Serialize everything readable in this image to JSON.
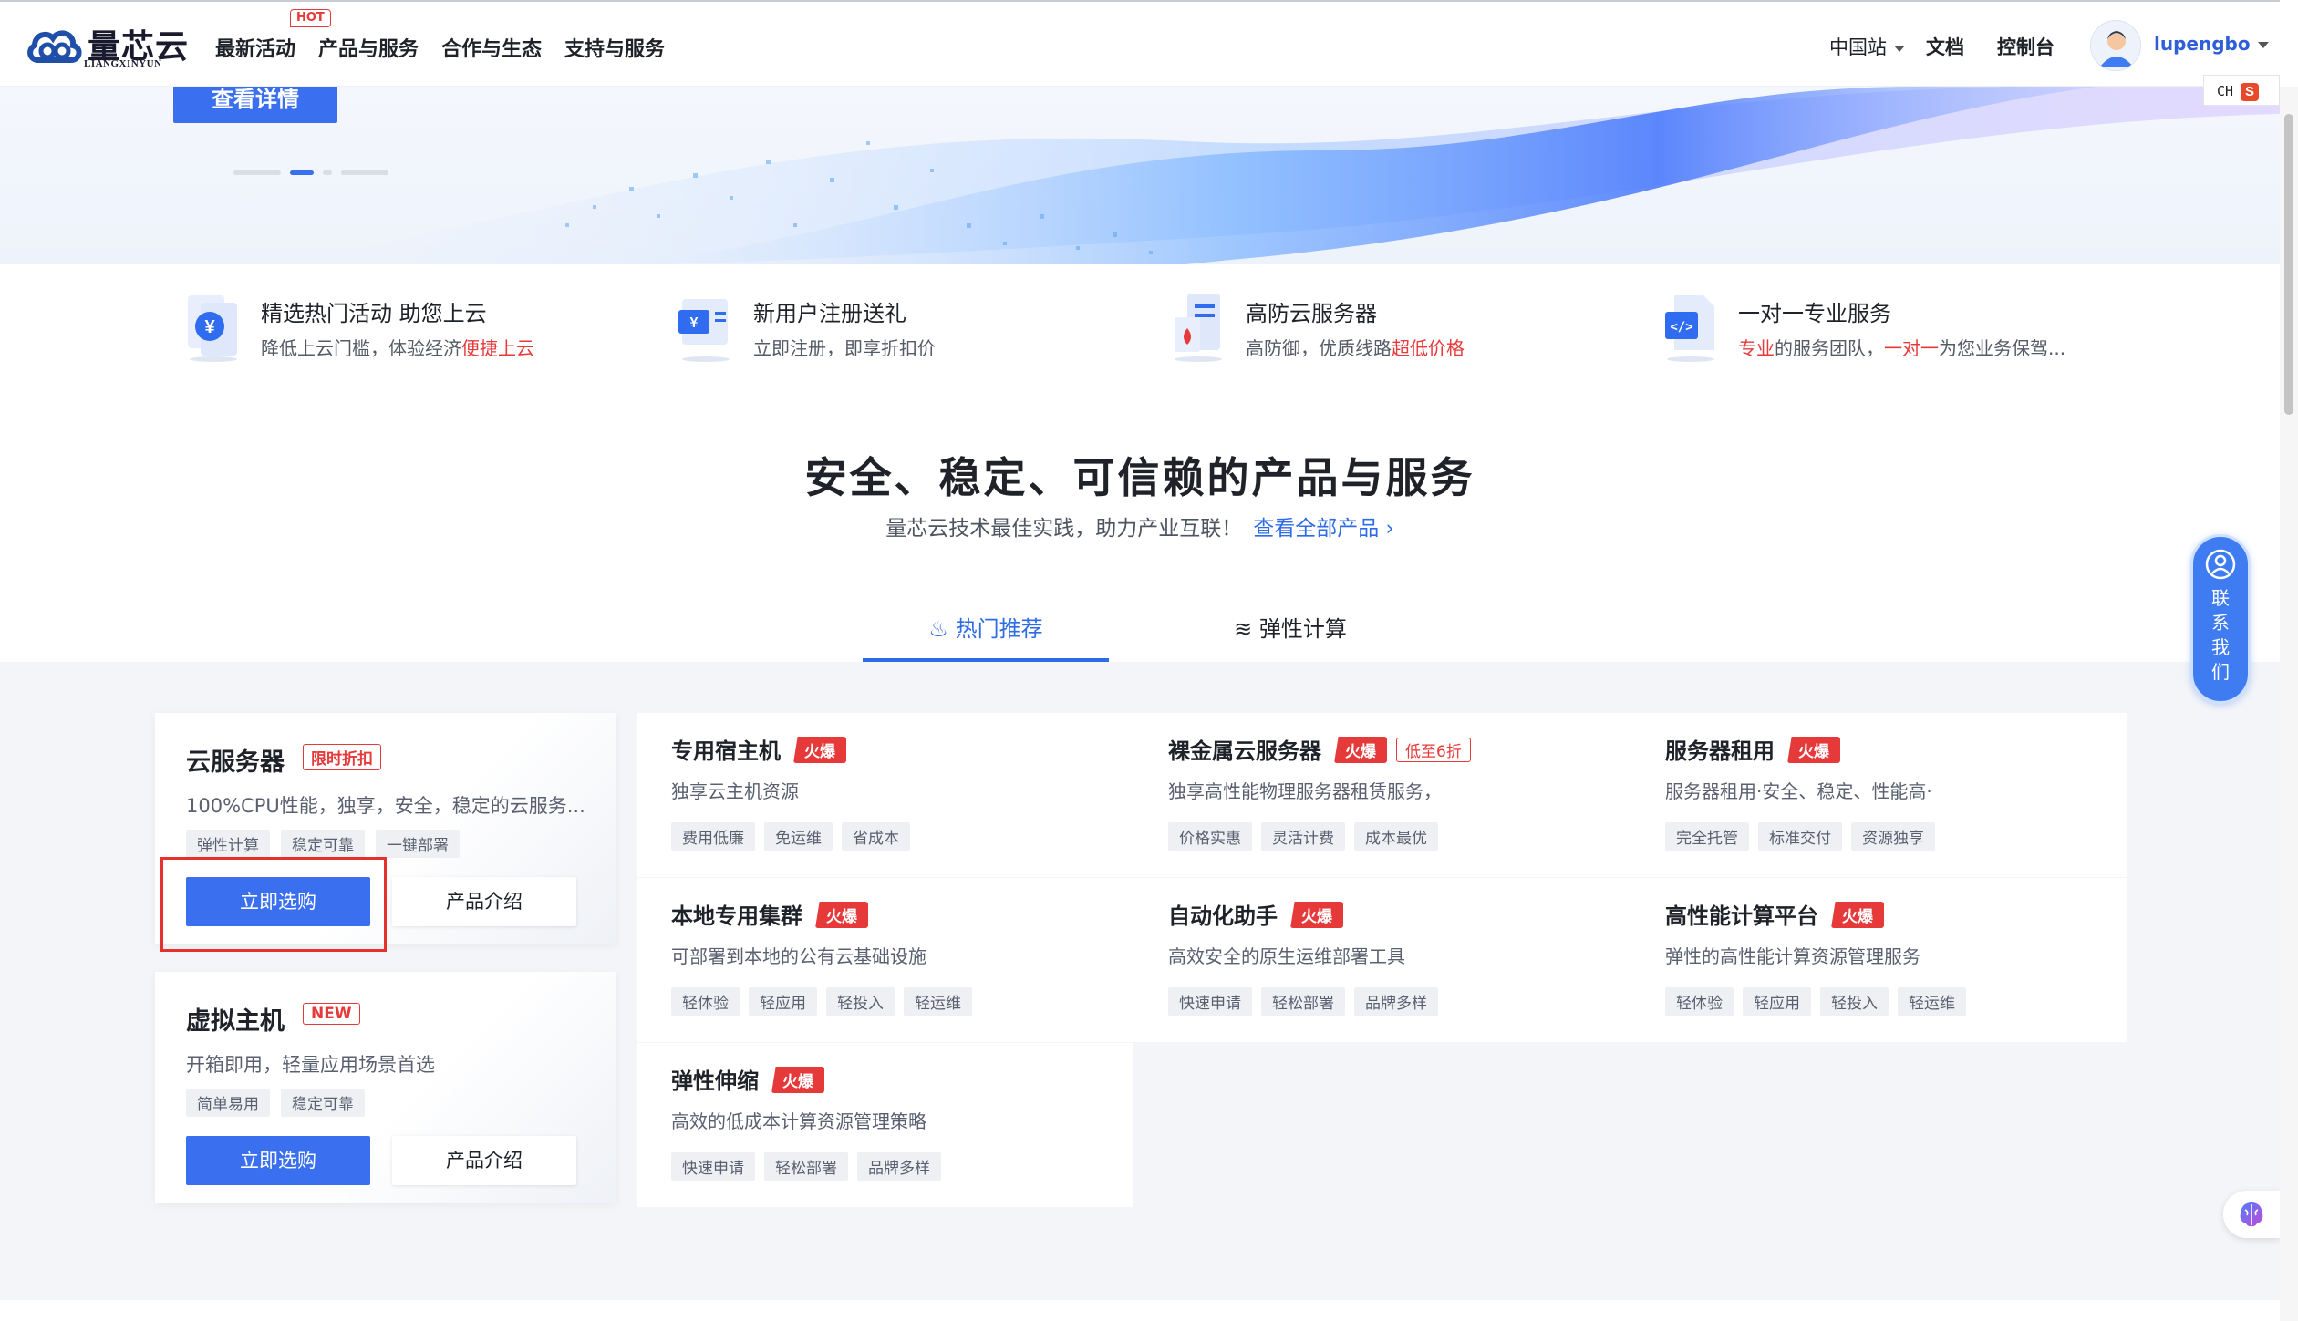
{
  "header": {
    "logo_text": "量芯云",
    "logo_sub": "LIANGXINYUN",
    "nav": [
      "最新活动",
      "产品与服务",
      "合作与生态",
      "支持与服务"
    ],
    "hot_tag": "HOT",
    "region": "中国站",
    "docs": "文档",
    "console": "控制台",
    "username": "lupengbo"
  },
  "ime": {
    "lang": "CH",
    "logo": "S"
  },
  "banner": {
    "button": "查看详情"
  },
  "features": [
    {
      "title": "精选热门活动 助您上云",
      "desc_plain": "降低上云门槛，体验经济",
      "desc_red": "便捷上云",
      "icon": "yen-coin-icon"
    },
    {
      "title": "新用户注册送礼",
      "desc_plain": "立即注册，即享折扣价",
      "icon": "gift-card-icon"
    },
    {
      "title": "高防云服务器",
      "desc_plain": "高防御，优质线路",
      "desc_red": "超低价格",
      "icon": "server-shield-icon"
    },
    {
      "title": "一对一专业服务",
      "desc_red1": "专业",
      "desc_mid1": "的服务团队，",
      "desc_red2": "一对一",
      "desc_mid2": "为您业务保驾...",
      "icon": "code-doc-icon"
    }
  ],
  "section": {
    "title": "安全、稳定、可信赖的产品与服务",
    "subtitle": "量芯云技术最佳实践，助力产业互联！",
    "link": "查看全部产品"
  },
  "tabs": [
    {
      "label": "热门推荐",
      "icon": "flame-icon",
      "active": true
    },
    {
      "label": "弹性计算",
      "icon": "layers-icon",
      "active": false
    }
  ],
  "left_cards": [
    {
      "title": "云服务器",
      "badge": "限时折扣",
      "desc": "100%CPU性能，独享，安全，稳定的云服务...",
      "tags": [
        "弹性计算",
        "稳定可靠",
        "一键部署"
      ],
      "buy": "立即选购",
      "intro": "产品介绍"
    },
    {
      "title": "虚拟主机",
      "badge": "NEW",
      "desc": "开箱即用，轻量应用场景首选",
      "tags": [
        "简单易用",
        "稳定可靠"
      ],
      "buy": "立即选购",
      "intro": "产品介绍"
    }
  ],
  "products": [
    {
      "title": "专用宿主机",
      "fire": "火爆",
      "desc": "独享云主机资源",
      "tags": [
        "费用低廉",
        "免运维",
        "省成本"
      ]
    },
    {
      "title": "裸金属云服务器",
      "fire": "火爆",
      "extra": "低至6折",
      "desc": "独享高性能物理服务器租赁服务，",
      "tags": [
        "价格实惠",
        "灵活计费",
        "成本最优"
      ]
    },
    {
      "title": "服务器租用",
      "fire": "火爆",
      "desc": "服务器租用·安全、稳定、性能高·",
      "tags": [
        "完全托管",
        "标准交付",
        "资源独享"
      ]
    },
    {
      "title": "本地专用集群",
      "fire": "火爆",
      "desc": "可部署到本地的公有云基础设施",
      "tags": [
        "轻体验",
        "轻应用",
        "轻投入",
        "轻运维"
      ]
    },
    {
      "title": "自动化助手",
      "fire": "火爆",
      "desc": "高效安全的原生运维部署工具",
      "tags": [
        "快速申请",
        "轻松部署",
        "品牌多样"
      ]
    },
    {
      "title": "高性能计算平台",
      "fire": "火爆",
      "desc": "弹性的高性能计算资源管理服务",
      "tags": [
        "轻体验",
        "轻应用",
        "轻投入",
        "轻运维"
      ]
    },
    {
      "title": "弹性伸缩",
      "fire": "火爆",
      "desc": "高效的低成本计算资源管理策略",
      "tags": [
        "快速申请",
        "轻松部署",
        "品牌多样"
      ]
    }
  ],
  "contact": {
    "label": "联系我们",
    "chars": [
      "联",
      "系",
      "我",
      "们"
    ]
  },
  "colors": {
    "primary": "#3a6ff0",
    "link": "#2e6be6",
    "hot": "#e6393a",
    "highlight_box": "#e5302c"
  }
}
